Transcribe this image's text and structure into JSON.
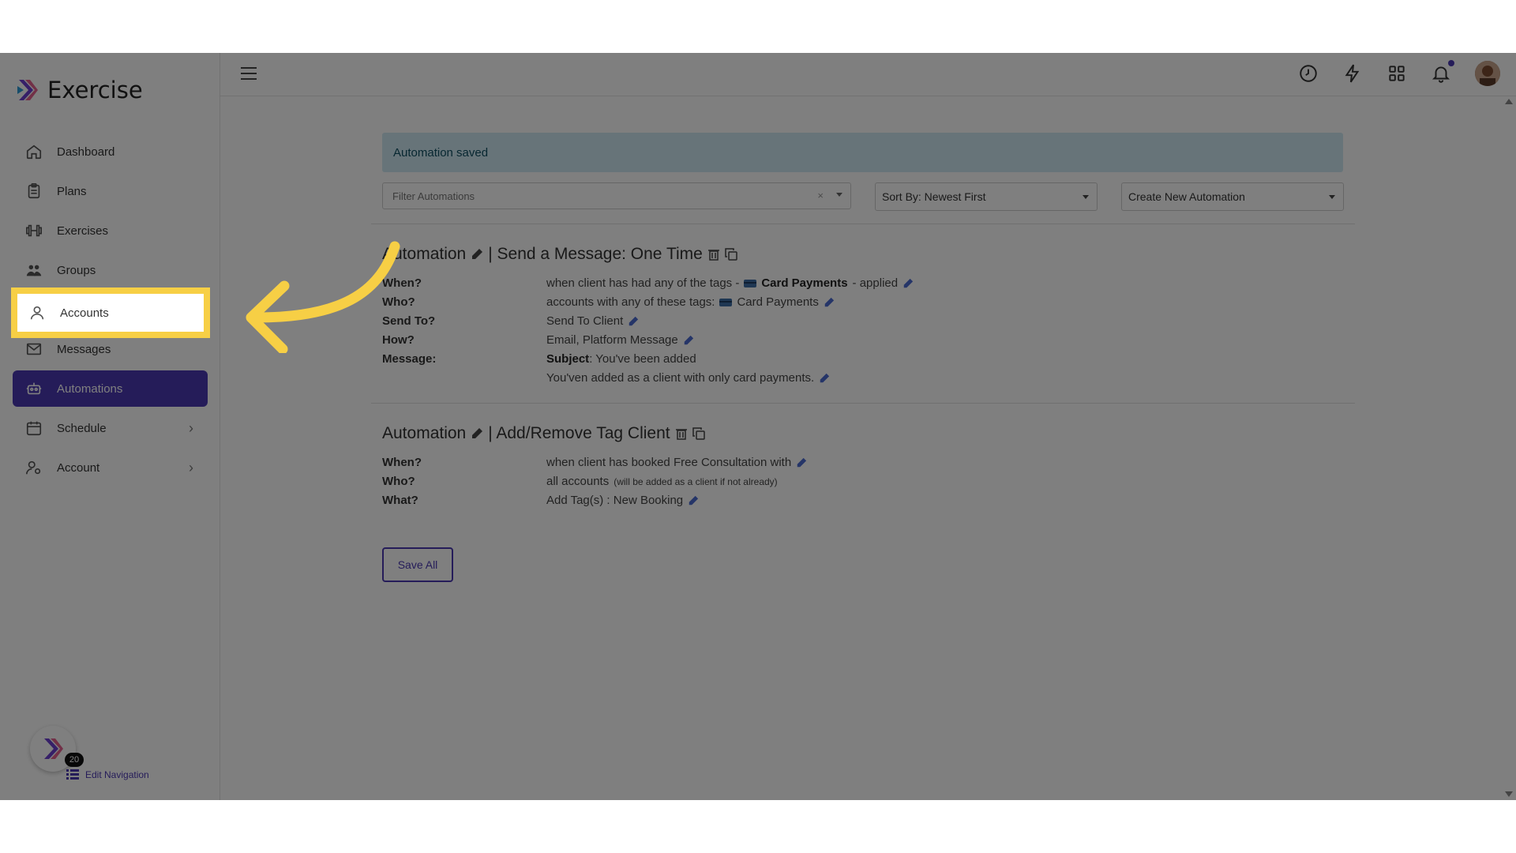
{
  "app": {
    "name": "Exercise"
  },
  "sidebar": {
    "items": [
      {
        "label": "Dashboard",
        "icon": "home-icon"
      },
      {
        "label": "Plans",
        "icon": "clipboard-icon"
      },
      {
        "label": "Exercises",
        "icon": "dumbbell-icon"
      },
      {
        "label": "Groups",
        "icon": "users-icon"
      },
      {
        "label": "Accounts",
        "icon": "user-icon"
      },
      {
        "label": "Messages",
        "icon": "mail-icon"
      },
      {
        "label": "Automations",
        "icon": "robot-icon"
      },
      {
        "label": "Schedule",
        "icon": "calendar-icon"
      },
      {
        "label": "Account",
        "icon": "user-gear-icon"
      }
    ],
    "badge_count": "20",
    "edit_navigation": "Edit Navigation"
  },
  "alert": {
    "text": "Automation saved"
  },
  "filter": {
    "placeholder": "Filter Automations",
    "clear": "×"
  },
  "sort": {
    "label": "Sort By: Newest First"
  },
  "create": {
    "label": "Create New Automation"
  },
  "automations": [
    {
      "title_prefix": "Automation",
      "title_suffix": "| Send a Message: One Time",
      "rows": {
        "when_label": "When?",
        "when_text": "when client has had any of the tags -",
        "when_tag": "Card Payments",
        "when_suffix": "- applied",
        "who_label": "Who?",
        "who_text": "accounts with any of these tags:",
        "who_tag": "Card Payments",
        "sendto_label": "Send To?",
        "sendto_text": "Send To Client",
        "how_label": "How?",
        "how_text": "Email, Platform Message",
        "message_label": "Message:",
        "subject_label": "Subject",
        "subject_text": ": You've been added",
        "body_text": "You'ven added as a client with only card payments."
      }
    },
    {
      "title_prefix": "Automation",
      "title_suffix": "| Add/Remove Tag Client",
      "rows": {
        "when_label": "When?",
        "when_text": "when client has booked Free Consultation with",
        "who_label": "Who?",
        "who_text": "all accounts",
        "who_note": "(will be added as a client if not already)",
        "what_label": "What?",
        "what_text": "Add Tag(s) : New Booking"
      }
    }
  ],
  "save_all": "Save All",
  "colors": {
    "accent": "#4b38b3",
    "highlight": "#f7cf45",
    "alert_bg": "#cfe9f2"
  }
}
